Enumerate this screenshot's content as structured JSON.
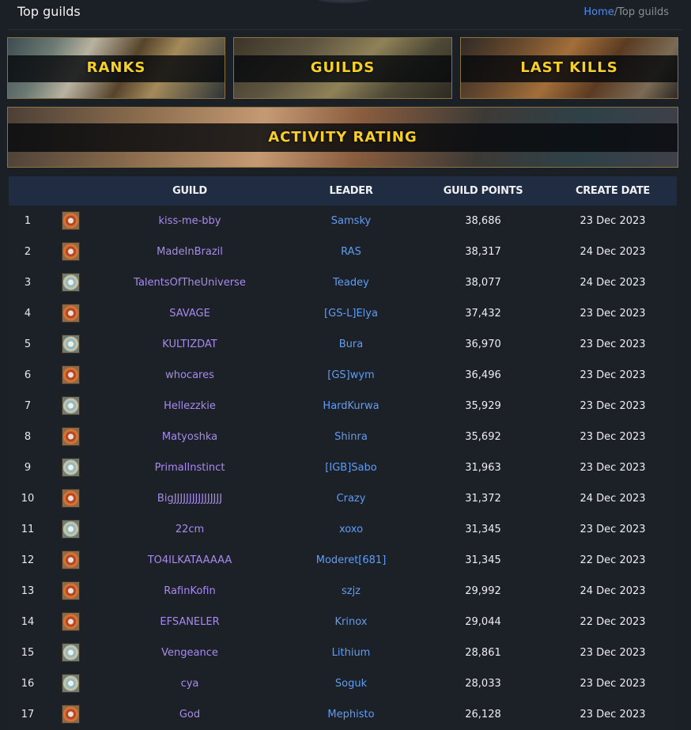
{
  "header": {
    "title": "Top guilds",
    "breadcrumb_home": "Home",
    "breadcrumb_sep": "/",
    "breadcrumb_current": "Top guilds"
  },
  "banners": {
    "ranks": "RANKS",
    "guilds": "GUILDS",
    "last_kills": "LAST KILLS",
    "activity_rating": "ACTIVITY RATING"
  },
  "table": {
    "columns": {
      "guild": "GUILD",
      "leader": "LEADER",
      "points": "GUILD POINTS",
      "date": "CREATE DATE"
    },
    "rows": [
      {
        "rank": "1",
        "emblem": "red-emblem",
        "guild": "kiss-me-bby",
        "leader": "Samsky",
        "points": "38,686",
        "date": "23 Dec 2023"
      },
      {
        "rank": "2",
        "emblem": "red-emblem",
        "guild": "MadeInBrazil",
        "leader": "RAS",
        "points": "38,317",
        "date": "24 Dec 2023"
      },
      {
        "rank": "3",
        "emblem": "blue-emblem",
        "guild": "TalentsOfTheUniverse",
        "leader": "Teadey",
        "points": "38,077",
        "date": "24 Dec 2023"
      },
      {
        "rank": "4",
        "emblem": "red-emblem",
        "guild": "SAVAGE",
        "leader": "[GS-L]Elya",
        "points": "37,432",
        "date": "23 Dec 2023"
      },
      {
        "rank": "5",
        "emblem": "blue-emblem",
        "guild": "KULTIZDAT",
        "leader": "Bura",
        "points": "36,970",
        "date": "23 Dec 2023"
      },
      {
        "rank": "6",
        "emblem": "red-emblem",
        "guild": "whocares",
        "leader": "[GS]wym",
        "points": "36,496",
        "date": "23 Dec 2023"
      },
      {
        "rank": "7",
        "emblem": "blue-emblem",
        "guild": "Hellezzkie",
        "leader": "HardKurwa",
        "points": "35,929",
        "date": "23 Dec 2023"
      },
      {
        "rank": "8",
        "emblem": "red-emblem",
        "guild": "Matyoshka",
        "leader": "Shinra",
        "points": "35,692",
        "date": "23 Dec 2023"
      },
      {
        "rank": "9",
        "emblem": "blue-emblem",
        "guild": "PrimalInstinct",
        "leader": "[IGB]Sabo",
        "points": "31,963",
        "date": "23 Dec 2023"
      },
      {
        "rank": "10",
        "emblem": "red-emblem",
        "guild": "BigJJJJJJJJJJJJJJJJ",
        "leader": "Crazy",
        "points": "31,372",
        "date": "24 Dec 2023"
      },
      {
        "rank": "11",
        "emblem": "blue-emblem",
        "guild": "22cm",
        "leader": "xoxo",
        "points": "31,345",
        "date": "23 Dec 2023"
      },
      {
        "rank": "12",
        "emblem": "red-emblem",
        "guild": "TO4ILKATAAAAA",
        "leader": "Moderet[681]",
        "points": "31,345",
        "date": "22 Dec 2023"
      },
      {
        "rank": "13",
        "emblem": "red-emblem",
        "guild": "RafinKofin",
        "leader": "szjz",
        "points": "29,992",
        "date": "24 Dec 2023"
      },
      {
        "rank": "14",
        "emblem": "red-emblem",
        "guild": "EFSANELER",
        "leader": "Krinox",
        "points": "29,044",
        "date": "22 Dec 2023"
      },
      {
        "rank": "15",
        "emblem": "blue-emblem",
        "guild": "Vengeance",
        "leader": "Lithium",
        "points": "28,861",
        "date": "23 Dec 2023"
      },
      {
        "rank": "16",
        "emblem": "blue-emblem",
        "guild": "cya",
        "leader": "Soguk",
        "points": "28,033",
        "date": "23 Dec 2023"
      },
      {
        "rank": "17",
        "emblem": "red-emblem",
        "guild": "God",
        "leader": "Mephisto",
        "points": "26,128",
        "date": "23 Dec 2023"
      }
    ]
  },
  "colors": {
    "accent_gold": "#f6cf2c",
    "guild_link": "#a88aee",
    "leader_link": "#5f9df5",
    "breadcrumb_link": "#4d8cf5"
  }
}
